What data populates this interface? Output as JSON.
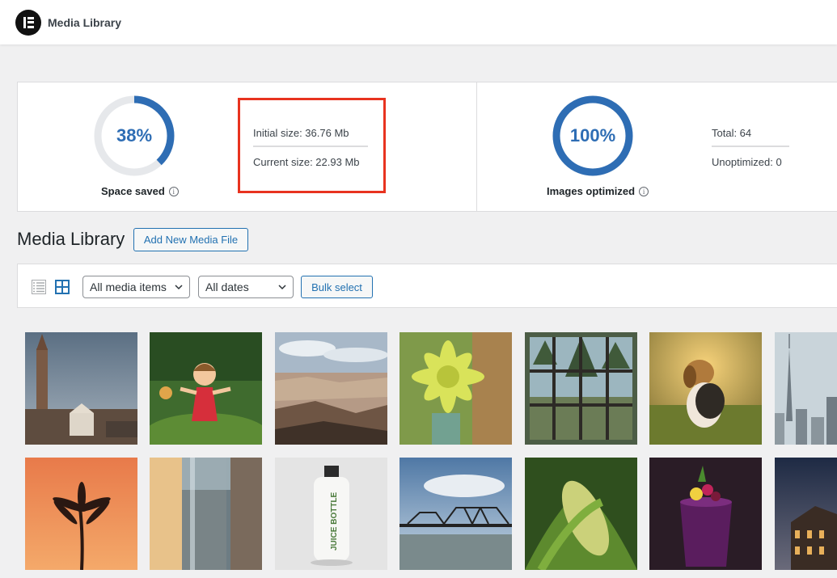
{
  "topbar": {
    "title": "Media Library",
    "logo_icon": "elementor-logo-icon"
  },
  "stats": {
    "space_saved": {
      "percent": 38,
      "value_text": "38%",
      "label": "Space saved",
      "color": "#2e6db4"
    },
    "initial_size": "Initial size: 36.76 Mb",
    "current_size": "Current size: 22.93 Mb",
    "images_optimized": {
      "percent": 100,
      "value_text": "100%",
      "label": "Images optimized",
      "color": "#2e6db4"
    },
    "total": "Total: 64",
    "unoptimized": "Unoptimized: 0",
    "highlight_color": "#e8331f"
  },
  "library": {
    "title": "Media Library",
    "add_new_label": "Add New Media File",
    "filter_type": "All media items",
    "filter_date": "All dates",
    "bulk_select_label": "Bulk select",
    "view_icons": [
      "list-view-icon",
      "grid-view-icon"
    ]
  },
  "media_items": [
    {
      "subject": "church-tower"
    },
    {
      "subject": "toy-figure"
    },
    {
      "subject": "canyon"
    },
    {
      "subject": "yellow-flower"
    },
    {
      "subject": "window-forest"
    },
    {
      "subject": "beagle-dog"
    },
    {
      "subject": "city-skyline"
    },
    {
      "subject": "palm-sunset"
    },
    {
      "subject": "glass-water"
    },
    {
      "subject": "juice-bottle",
      "text": "JUICE BOTTLE"
    },
    {
      "subject": "bridge-river"
    },
    {
      "subject": "corn"
    },
    {
      "subject": "cocktail"
    },
    {
      "subject": "building-dusk"
    }
  ]
}
